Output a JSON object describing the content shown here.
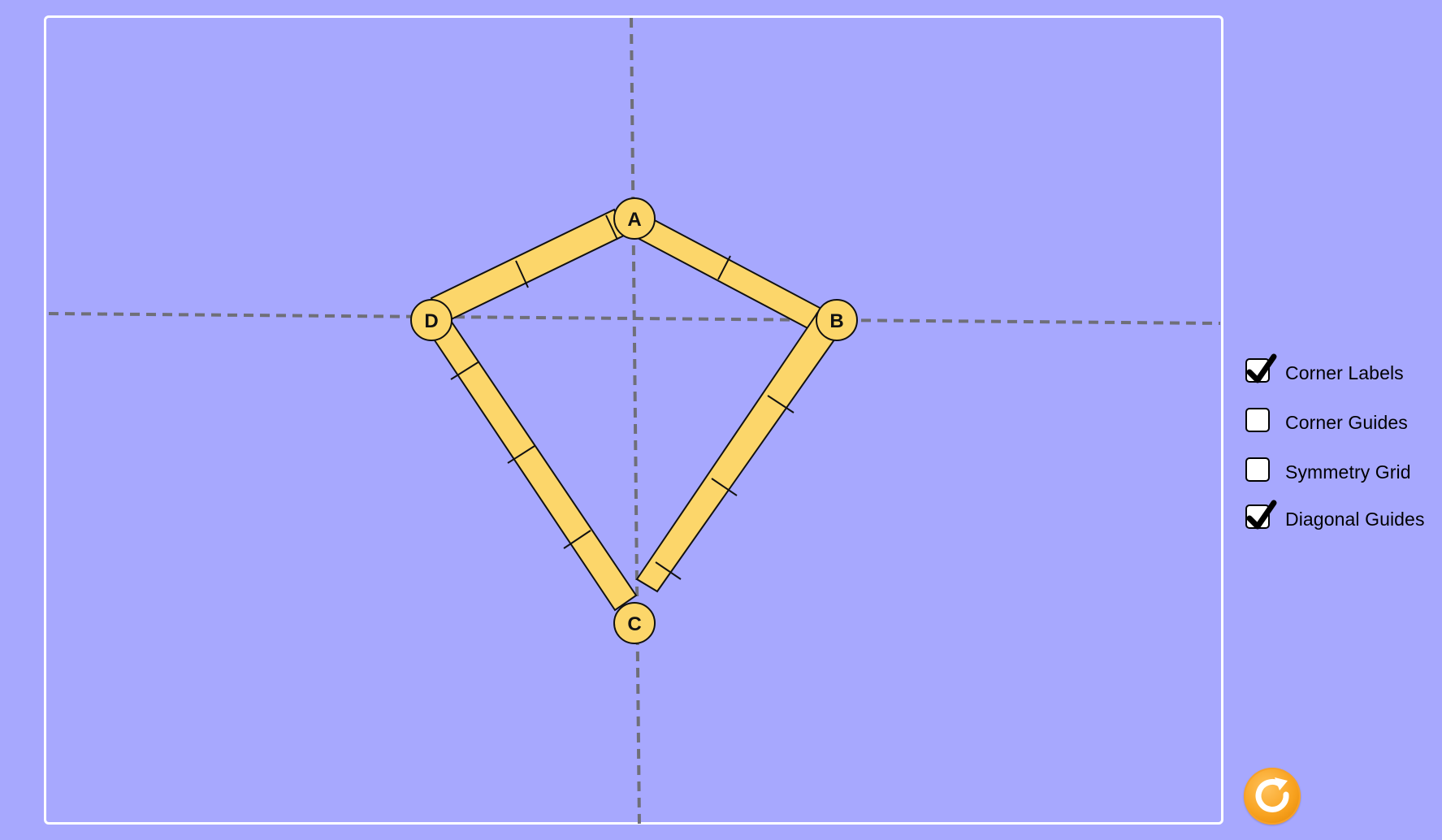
{
  "kite": {
    "vertex_labels": [
      "A",
      "B",
      "C",
      "D"
    ]
  },
  "options": [
    {
      "label": "Corner Labels",
      "checked": true
    },
    {
      "label": "Corner Guides",
      "checked": false
    },
    {
      "label": "Symmetry Grid",
      "checked": false
    },
    {
      "label": "Diagonal Guides",
      "checked": true
    }
  ],
  "reset": {
    "icon": "reset-arrow-icon"
  },
  "colors": {
    "background": "#a7a8fe",
    "frame": "#ffffff",
    "strip_fill": "#fcd66a",
    "outline": "#111111",
    "guide_line": "#6f6f78",
    "reset_button": "#f8a21f"
  }
}
